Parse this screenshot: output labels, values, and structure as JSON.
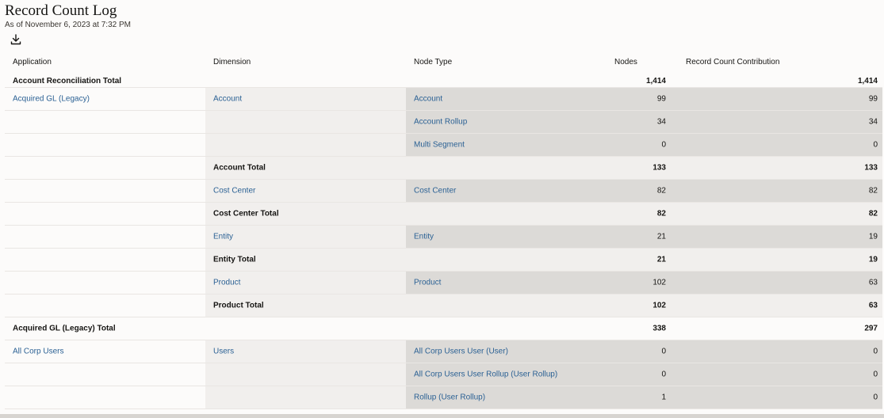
{
  "page": {
    "title": "Record Count Log",
    "subtitle": "As of November 6, 2023 at 7:32 PM",
    "download_icon": "download-icon"
  },
  "columns": {
    "application": "Application",
    "dimension": "Dimension",
    "node_type": "Node Type",
    "nodes": "Nodes",
    "record_count_contribution": "Record Count Contribution"
  },
  "rows": [
    {
      "kind": "app-total",
      "application": "Account Reconciliation Total",
      "nodes": "1,414",
      "rcc": "1,414"
    },
    {
      "kind": "detail",
      "application": "Acquired GL (Legacy)",
      "dimension": "Account",
      "node_type": "Account",
      "nodes": "99",
      "rcc": "99"
    },
    {
      "kind": "detail",
      "application": "",
      "dimension": "",
      "node_type": "Account Rollup",
      "nodes": "34",
      "rcc": "34"
    },
    {
      "kind": "detail",
      "application": "",
      "dimension": "",
      "node_type": "Multi Segment",
      "nodes": "0",
      "rcc": "0"
    },
    {
      "kind": "dim-total",
      "dimension": "Account Total",
      "nodes": "133",
      "rcc": "133"
    },
    {
      "kind": "detail",
      "application": "",
      "dimension": "Cost Center",
      "node_type": "Cost Center",
      "nodes": "82",
      "rcc": "82"
    },
    {
      "kind": "dim-total",
      "dimension": "Cost Center Total",
      "nodes": "82",
      "rcc": "82"
    },
    {
      "kind": "detail",
      "application": "",
      "dimension": "Entity",
      "node_type": "Entity",
      "nodes": "21",
      "rcc": "19"
    },
    {
      "kind": "dim-total",
      "dimension": "Entity Total",
      "nodes": "21",
      "rcc": "19"
    },
    {
      "kind": "detail",
      "application": "",
      "dimension": "Product",
      "node_type": "Product",
      "nodes": "102",
      "rcc": "63"
    },
    {
      "kind": "dim-total",
      "dimension": "Product Total",
      "nodes": "102",
      "rcc": "63"
    },
    {
      "kind": "app-total",
      "application": "Acquired GL (Legacy) Total",
      "nodes": "338",
      "rcc": "297"
    },
    {
      "kind": "detail",
      "application": "All Corp Users",
      "dimension": "Users",
      "node_type": "All Corp Users User (User)",
      "nodes": "0",
      "rcc": "0"
    },
    {
      "kind": "detail",
      "application": "",
      "dimension": "",
      "node_type": "All Corp Users User Rollup (User Rollup)",
      "nodes": "0",
      "rcc": "0"
    },
    {
      "kind": "detail",
      "application": "",
      "dimension": "",
      "node_type": "Rollup (User Rollup)",
      "nodes": "1",
      "rcc": "0"
    }
  ]
}
